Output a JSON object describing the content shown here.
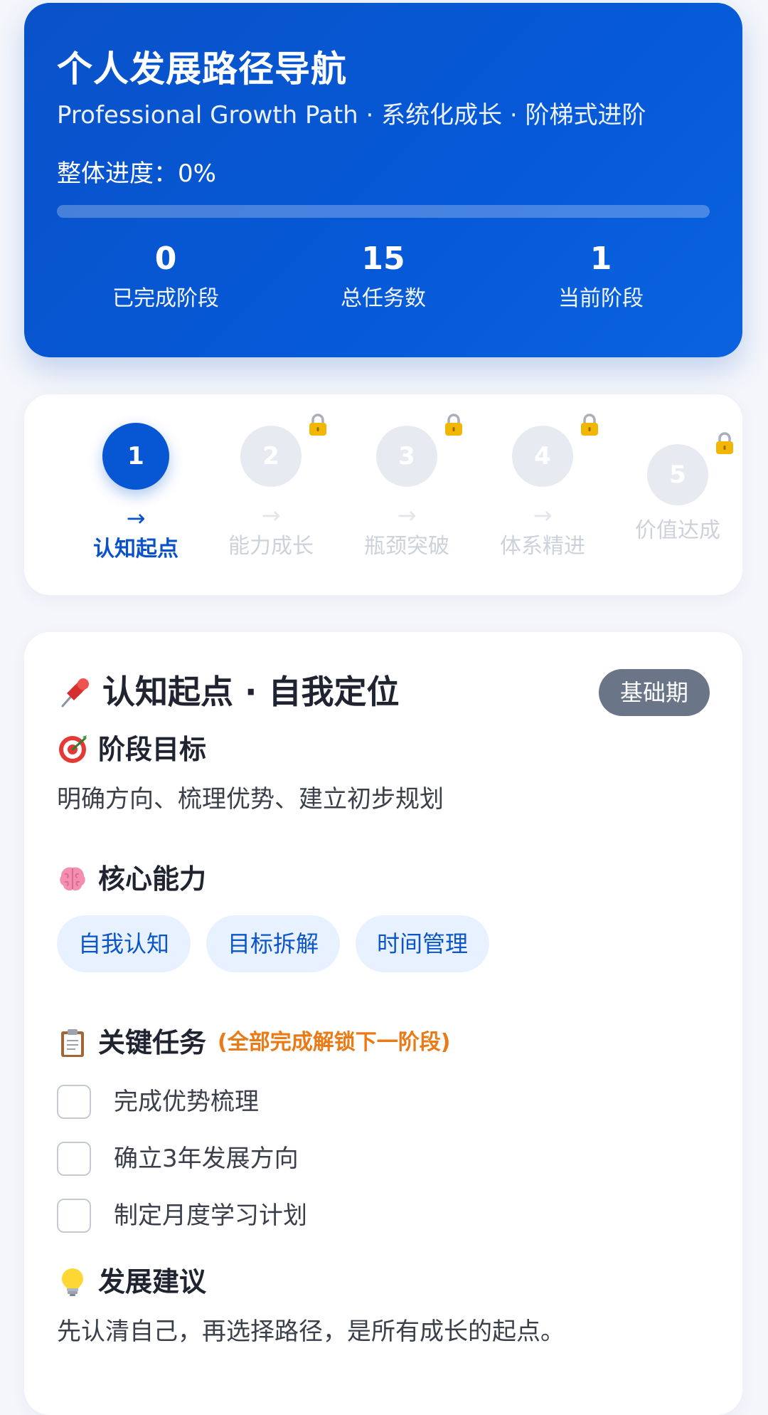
{
  "header": {
    "title": "个人发展路径导航",
    "subtitle": "Professional Growth Path · 系统化成长 · 阶梯式进阶",
    "progress_label": "整体进度：0%",
    "progress_fraction": 0,
    "stats": [
      {
        "value": "0",
        "label": "已完成阶段"
      },
      {
        "value": "15",
        "label": "总任务数"
      },
      {
        "value": "1",
        "label": "当前阶段"
      }
    ]
  },
  "steps": [
    {
      "number": "1",
      "arrow": "→",
      "label": "认知起点",
      "active": true,
      "locked": false
    },
    {
      "number": "2",
      "arrow": "→",
      "label": "能力成长",
      "active": false,
      "locked": true
    },
    {
      "number": "3",
      "arrow": "→",
      "label": "瓶颈突破",
      "active": false,
      "locked": true
    },
    {
      "number": "4",
      "arrow": "→",
      "label": "体系精进",
      "active": false,
      "locked": true
    },
    {
      "number": "5",
      "arrow": "",
      "label": "价值达成",
      "active": false,
      "locked": true
    }
  ],
  "stage": {
    "title": "认知起点 · 自我定位",
    "badge": "基础期",
    "goal_title": "阶段目标",
    "goal_text": "明确方向、梳理优势、建立初步规划",
    "ability_title": "核心能力",
    "abilities": [
      "自我认知",
      "目标拆解",
      "时间管理"
    ],
    "tasks_title": "关键任务",
    "tasks_note": "(全部完成解锁下一阶段)",
    "tasks": [
      {
        "label": "完成优势梳理",
        "checked": false
      },
      {
        "label": "确立3年发展方向",
        "checked": false
      },
      {
        "label": "制定月度学习计划",
        "checked": false
      }
    ],
    "advice_title": "发展建议",
    "advice_text": "先认清自己，再选择路径，是所有成长的起点。"
  },
  "icons": {
    "title": "pushpin-icon",
    "goal": "target-icon",
    "ability": "brain-icon",
    "tasks": "clipboard-icon",
    "advice": "lightbulb-icon",
    "locked": "lock-icon"
  },
  "colors": {
    "primary": "#0756d3",
    "badge": "#6a7687",
    "chip_bg": "#e8f1ff",
    "note": "#ea7a16"
  }
}
